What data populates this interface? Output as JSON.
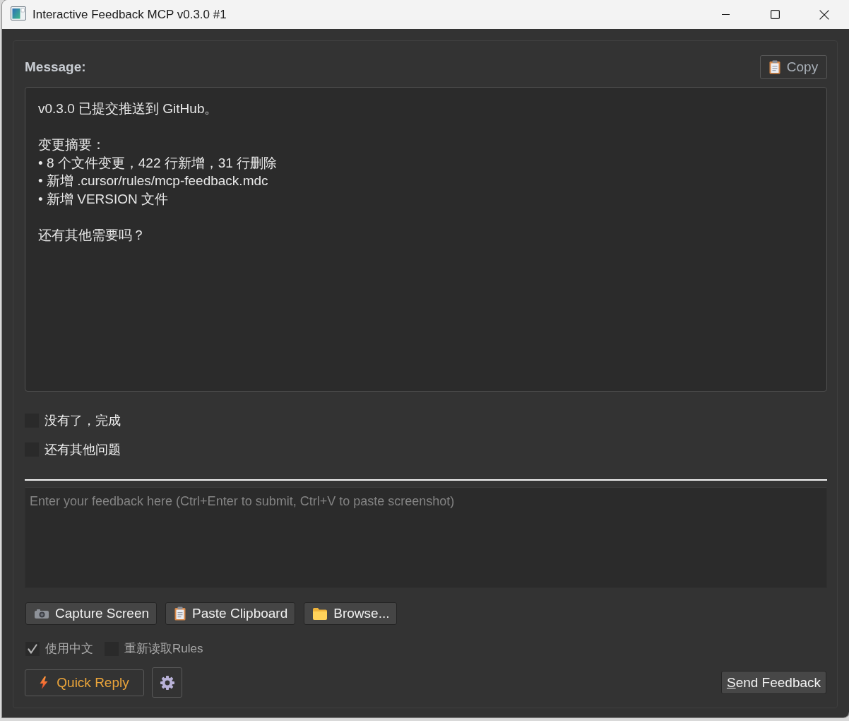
{
  "window": {
    "title": "Interactive Feedback MCP v0.3.0 #1"
  },
  "message": {
    "label": "Message:",
    "copy_button": {
      "label": "Copy"
    },
    "paragraphs": [
      [
        "v0.3.0 已提交推送到 GitHub。"
      ],
      [
        "变更摘要：",
        "• 8 个文件变更，422 行新增，31 行删除",
        "• 新增 .cursor/rules/mcp-feedback.mdc",
        "• 新增 VERSION 文件"
      ],
      [
        "还有其他需要吗？"
      ]
    ]
  },
  "options": [
    {
      "label": "没有了，完成",
      "checked": false
    },
    {
      "label": "还有其他问题",
      "checked": false
    }
  ],
  "feedback": {
    "placeholder": "Enter your feedback here (Ctrl+Enter to submit, Ctrl+V to paste screenshot)"
  },
  "attachment_buttons": [
    {
      "kind": "camera",
      "label": "Capture Screen"
    },
    {
      "kind": "clipboard",
      "label": "Paste Clipboard"
    },
    {
      "kind": "folder",
      "label": "Browse..."
    }
  ],
  "settings": [
    {
      "label": "使用中文",
      "checked": true
    },
    {
      "label": "重新读取Rules",
      "checked": false
    }
  ],
  "quick_reply": {
    "label": "Quick Reply"
  },
  "send_button": {
    "label": "Send Feedback",
    "mnemonic_underlined": true
  }
}
